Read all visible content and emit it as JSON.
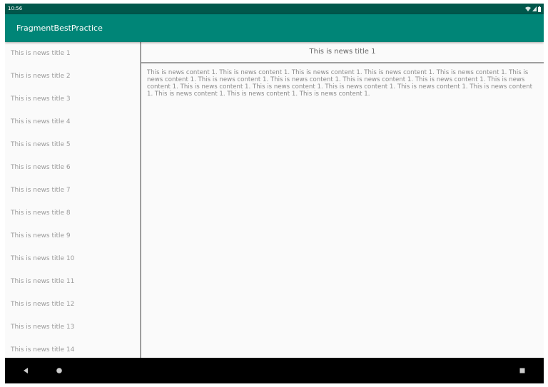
{
  "status_bar": {
    "time": "10:56"
  },
  "app_bar": {
    "title": "FragmentBestPractice"
  },
  "news_list": [
    {
      "title": "This is news title 1"
    },
    {
      "title": "This is news title 2"
    },
    {
      "title": "This is news title 3"
    },
    {
      "title": "This is news title 4"
    },
    {
      "title": "This is news title 5"
    },
    {
      "title": "This is news title 6"
    },
    {
      "title": "This is news title 7"
    },
    {
      "title": "This is news title 8"
    },
    {
      "title": "This is news title 9"
    },
    {
      "title": "This is news title 10"
    },
    {
      "title": "This is news title 11"
    },
    {
      "title": "This is news title 12"
    },
    {
      "title": "This is news title 13"
    },
    {
      "title": "This is news title 14"
    }
  ],
  "detail": {
    "title": "This is news title 1",
    "content": "This is news content 1. This is news content 1. This is news content 1. This is news content 1. This is news content 1. This is news content 1. This is news content 1. This is news content 1. This is news content 1. This is news content 1. This is news content 1. This is news content 1. This is news content 1. This is news content 1. This is news content 1. This is news content 1. This is news content 1. This is news content 1. This is news content 1."
  },
  "colors": {
    "status_bar": "#00574b",
    "app_bar": "#008577",
    "nav_bar": "#000000"
  },
  "icons": {
    "status": [
      "wifi-icon",
      "signal-icon",
      "battery-icon"
    ],
    "nav": [
      "back-icon",
      "home-icon",
      "recents-icon"
    ]
  }
}
